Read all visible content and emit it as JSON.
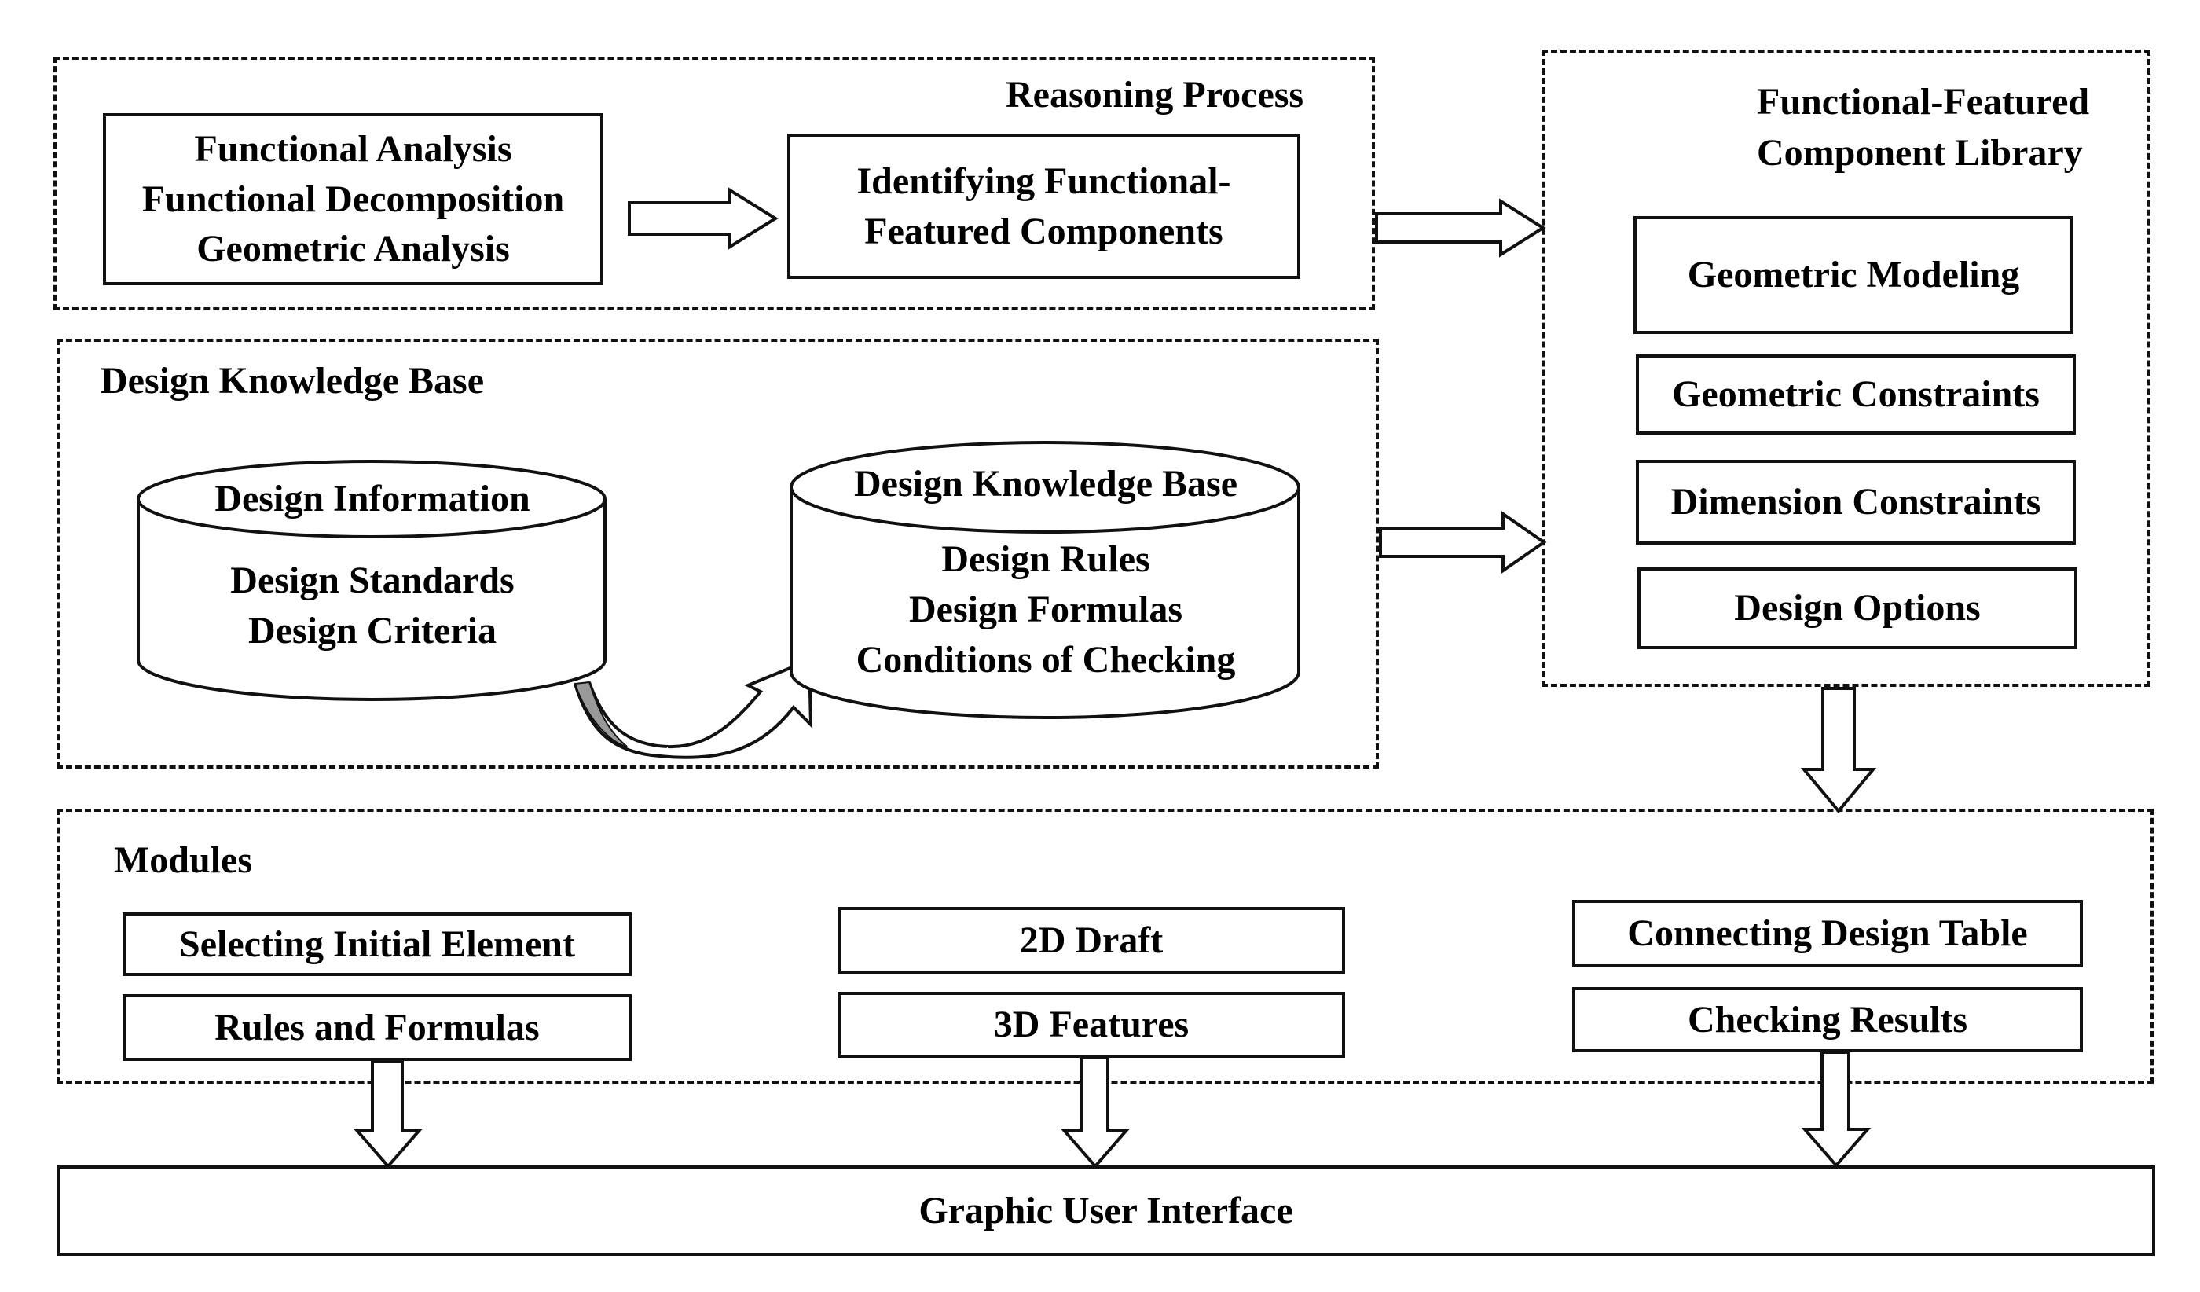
{
  "reasoning": {
    "title": "Reasoning Process",
    "analysis_lines": [
      "Functional Analysis",
      "Functional Decomposition",
      "Geometric Analysis"
    ],
    "identify_lines": [
      "Identifying Functional-",
      "Featured Components"
    ]
  },
  "library": {
    "title_lines": [
      "Functional-Featured",
      "Component Library"
    ],
    "items": [
      "Geometric Modeling",
      "Geometric Constraints",
      "Dimension Constraints",
      "Design Options"
    ]
  },
  "knowledge": {
    "title": "Design Knowledge Base",
    "info_db": {
      "top": "Design Information",
      "lines": [
        "Design Standards",
        "Design Criteria"
      ]
    },
    "kb_db": {
      "top": "Design Knowledge Base",
      "lines": [
        "Design Rules",
        "Design Formulas",
        "Conditions of Checking"
      ]
    }
  },
  "modules": {
    "title": "Modules",
    "col1": [
      "Selecting Initial Element",
      "Rules and Formulas"
    ],
    "col2": [
      "2D Draft",
      "3D Features"
    ],
    "col3": [
      "Connecting Design Table",
      "Checking Results"
    ]
  },
  "gui": {
    "label": "Graphic User Interface"
  }
}
